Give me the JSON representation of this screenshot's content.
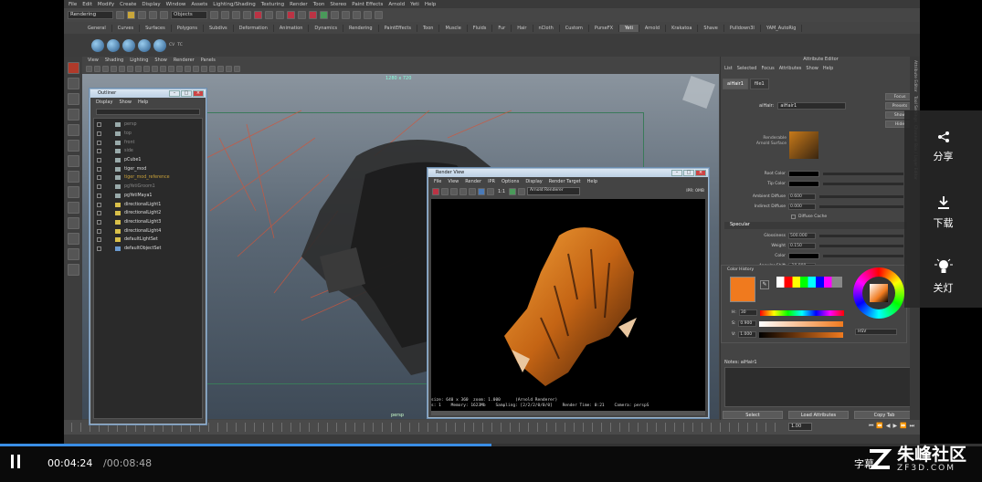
{
  "maya": {
    "menu": [
      "File",
      "Edit",
      "Modify",
      "Create",
      "Display",
      "Window",
      "Assets",
      "Lighting/Shading",
      "Texturing",
      "Render",
      "Toon",
      "Stereo",
      "Paint Effects",
      "Arnold",
      "Yeti",
      "Help"
    ],
    "mode": "Rendering",
    "objects_field": "Objects",
    "shelf_tabs": [
      "General",
      "Curves",
      "Surfaces",
      "Polygons",
      "Subdivs",
      "Deformation",
      "Animation",
      "Dynamics",
      "Rendering",
      "PaintEffects",
      "Toon",
      "Muscle",
      "Fluids",
      "Fur",
      "Hair",
      "nCloth",
      "Custom",
      "PurseFX",
      "Yeti",
      "Arnold",
      "Krakatoa",
      "Shave",
      "Pulldown3I",
      "YAM_AutoRig"
    ],
    "shelf_active": "Yeti",
    "shelf_labels": [
      "CV",
      "TC"
    ],
    "panel_menu": [
      "View",
      "Shading",
      "Lighting",
      "Show",
      "Renderer",
      "Panels"
    ],
    "resolution_label": "1280 x 720",
    "camera_label": "persp",
    "timeline_value": "1.00"
  },
  "outliner": {
    "title": "Outliner",
    "menu": [
      "Display",
      "Show",
      "Help"
    ],
    "items": [
      {
        "label": "persp",
        "style": "dim"
      },
      {
        "label": "top",
        "style": "dim"
      },
      {
        "label": "front",
        "style": "dim"
      },
      {
        "label": "side",
        "style": "dim"
      },
      {
        "label": "pCube1",
        "style": "normal"
      },
      {
        "label": "tiger_mod",
        "style": "normal"
      },
      {
        "label": "tiger_mod_reference",
        "style": "gold"
      },
      {
        "label": "pgYetiGroom1",
        "style": "dim"
      },
      {
        "label": "pgYetiMaya1",
        "style": "normal"
      },
      {
        "label": "directionalLight1",
        "style": "normal"
      },
      {
        "label": "directionalLight2",
        "style": "normal"
      },
      {
        "label": "directionalLight3",
        "style": "normal"
      },
      {
        "label": "directionalLight4",
        "style": "normal"
      },
      {
        "label": "defaultLightSet",
        "style": "normal"
      },
      {
        "label": "defaultObjectSet",
        "style": "normal"
      }
    ]
  },
  "render_view": {
    "title": "Render View",
    "menu": [
      "File",
      "View",
      "Render",
      "IPR",
      "Options",
      "Display",
      "Render Target",
      "Help"
    ],
    "renderer": "Arnold Renderer",
    "ipr_stat": "IPR: 0MB",
    "ratio": "1:1",
    "info_line1": "size: 640 x 360  zoom: 1.000      (Arnold Renderer)",
    "info_line2": "s: 1    Memory: 1623Mb    Sampling: [2/2/2/0/0/0]    Render Time: 0:21    Camera: perspS"
  },
  "attribute_editor": {
    "title": "Attribute Editor",
    "menu": [
      "List",
      "Selected",
      "Focus",
      "Attributes",
      "Show",
      "Help"
    ],
    "tabs": [
      "aiHair1",
      "file1"
    ],
    "node_label": "aiHair:",
    "node_value": "aiHair1",
    "side_buttons": [
      "Focus",
      "Presets",
      "Show",
      "Hide"
    ],
    "sample_label": "Renderable Arnold Surface",
    "rows_top": [
      {
        "label": "Root Color",
        "kind": "color"
      },
      {
        "label": "Tip Color",
        "kind": "color"
      },
      {
        "label": "Ambient Diffuse",
        "value": "0.600"
      },
      {
        "label": "Indirect Diffuse",
        "value": "0.000"
      }
    ],
    "diffuse_cache": "Diffuse Cache",
    "specular_header": "Specular",
    "rows_spec": [
      {
        "label": "Glossiness",
        "value": "500.000"
      },
      {
        "label": "Weight",
        "value": "0.150"
      },
      {
        "label": "Color",
        "kind": "color"
      },
      {
        "label": "Angular Shift",
        "value": "-10.000"
      }
    ],
    "notes_label": "Notes: aiHair1",
    "buttons": [
      "Select",
      "Load Attributes",
      "Copy Tab"
    ],
    "side_strip": [
      "Attribute Editor",
      "Tool Settings",
      "Channel Box / Layer Editor"
    ]
  },
  "color_history": {
    "label": "Color History",
    "h_label": "H:",
    "h_value": "30",
    "s_label": "S:",
    "s_value": "0.900",
    "v_label": "V:",
    "v_value": "1.000",
    "mode": "HSV",
    "current_color": "#f07a1e"
  },
  "overlay": {
    "share": "分享",
    "download": "下载",
    "lights_off": "关灯"
  },
  "player": {
    "current_time": "00:04:24",
    "total_time": "/00:08:48",
    "progress": 0.5,
    "subtitle_btn": "字幕",
    "logo_cn": "朱峰社区",
    "logo_en": "ZF3D.COM"
  }
}
